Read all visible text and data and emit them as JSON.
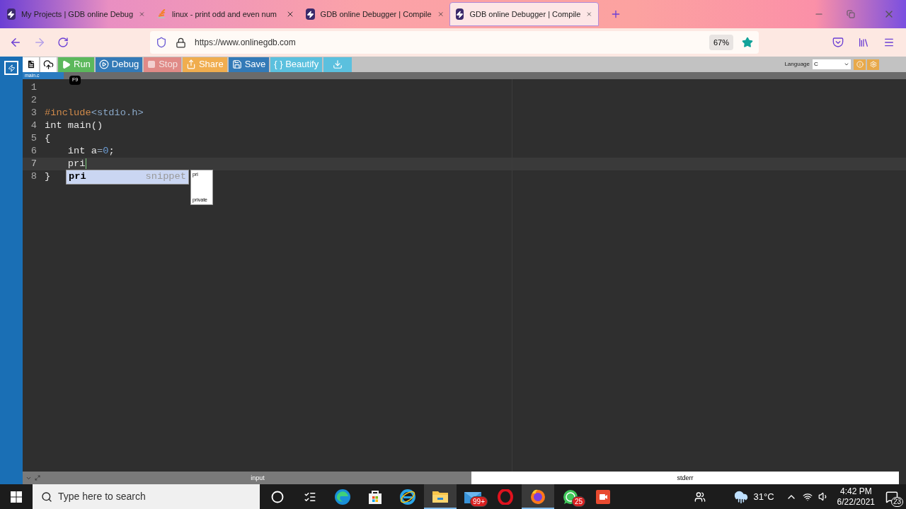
{
  "browser": {
    "tabs": [
      {
        "title": "My Projects | GDB online Debug",
        "kind": "bolt",
        "selected": false
      },
      {
        "title": "linux - print odd and even num",
        "kind": "stack",
        "selected": false
      },
      {
        "title": "GDB online Debugger | Compile",
        "kind": "bolt",
        "selected": false
      },
      {
        "title": "GDB online Debugger | Compile",
        "kind": "bolt",
        "selected": true
      }
    ],
    "address": "https://www.onlinegdb.com",
    "zoom": "67%"
  },
  "toolbar": {
    "buttons": [
      {
        "kind": "file",
        "color": "#ffffff",
        "disabled": false
      },
      {
        "kind": "upload",
        "color": "#ffffff",
        "disabled": false
      },
      {
        "kind": "play",
        "label": "Run",
        "color": "#5cb85c",
        "disabled": false
      },
      {
        "kind": "debug",
        "label": "Debug",
        "color": "#337ab7",
        "disabled": false
      },
      {
        "kind": "stop",
        "label": "Stop",
        "color": "#e08a87",
        "disabled": true
      },
      {
        "kind": "share",
        "label": "Share",
        "color": "#f0ad4e",
        "disabled": false
      },
      {
        "kind": "save",
        "label": "Save",
        "color": "#337ab7",
        "disabled": false
      },
      {
        "kind": "text",
        "label": "{ } Beautify",
        "color": "#5bc0de",
        "disabled": false
      },
      {
        "kind": "download",
        "color": "#5bc0de",
        "disabled": false
      }
    ],
    "tooltip": "F9",
    "language_label": "Language",
    "language": "C"
  },
  "editor": {
    "file_tab": "main.c",
    "lines": [
      {
        "number": "1",
        "active": false
      },
      {
        "number": "2",
        "active": false
      },
      {
        "number": "3",
        "active": false,
        "segments": [
          {
            "text": "#include",
            "kind": "directive"
          },
          {
            "text": "<stdio.h>",
            "kind": "header"
          }
        ]
      },
      {
        "number": "4",
        "active": false,
        "segments": [
          {
            "text": "int main()",
            "kind": "plain"
          }
        ]
      },
      {
        "number": "5",
        "active": false,
        "segments": [
          {
            "text": "{",
            "kind": "plain"
          }
        ]
      },
      {
        "number": "6",
        "active": false,
        "segments": [
          {
            "text": "    int a",
            "kind": "plain"
          },
          {
            "text": "=",
            "kind": "operator"
          },
          {
            "text": "0",
            "kind": "number"
          },
          {
            "text": ";",
            "kind": "plain"
          }
        ]
      },
      {
        "number": "7",
        "active": true,
        "segments": [
          {
            "text": "    pri",
            "kind": "plain"
          }
        ]
      },
      {
        "number": "8",
        "active": false,
        "segments": [
          {
            "text": "}",
            "kind": "plain"
          }
        ]
      }
    ],
    "autocomplete": {
      "items": [
        {
          "label": "pri",
          "meta": "snippet",
          "selected": true
        }
      ],
      "doc_title": "pri",
      "doc_body": "private"
    }
  },
  "bottom_tabs": [
    {
      "label": "input",
      "selected": false
    },
    {
      "label": "stderr",
      "selected": true
    }
  ],
  "taskbar": {
    "search_placeholder": "Type here to search",
    "apps": [
      {
        "kind": "cortana",
        "selected": false
      },
      {
        "kind": "taskview",
        "selected": false
      },
      {
        "kind": "edge",
        "selected": false
      },
      {
        "kind": "store",
        "selected": false
      },
      {
        "kind": "ie",
        "selected": false
      },
      {
        "kind": "explorer",
        "selected": true
      },
      {
        "kind": "mail",
        "badge": "99+",
        "selected": false
      },
      {
        "kind": "opera",
        "selected": false
      },
      {
        "kind": "firefox",
        "selected": true
      },
      {
        "kind": "whatsapp",
        "badge": "25",
        "selected": false
      },
      {
        "kind": "recorder",
        "selected": false
      }
    ],
    "weather": "31°C",
    "time": "4:42 PM",
    "date": "6/22/2021",
    "notifications": "23"
  }
}
